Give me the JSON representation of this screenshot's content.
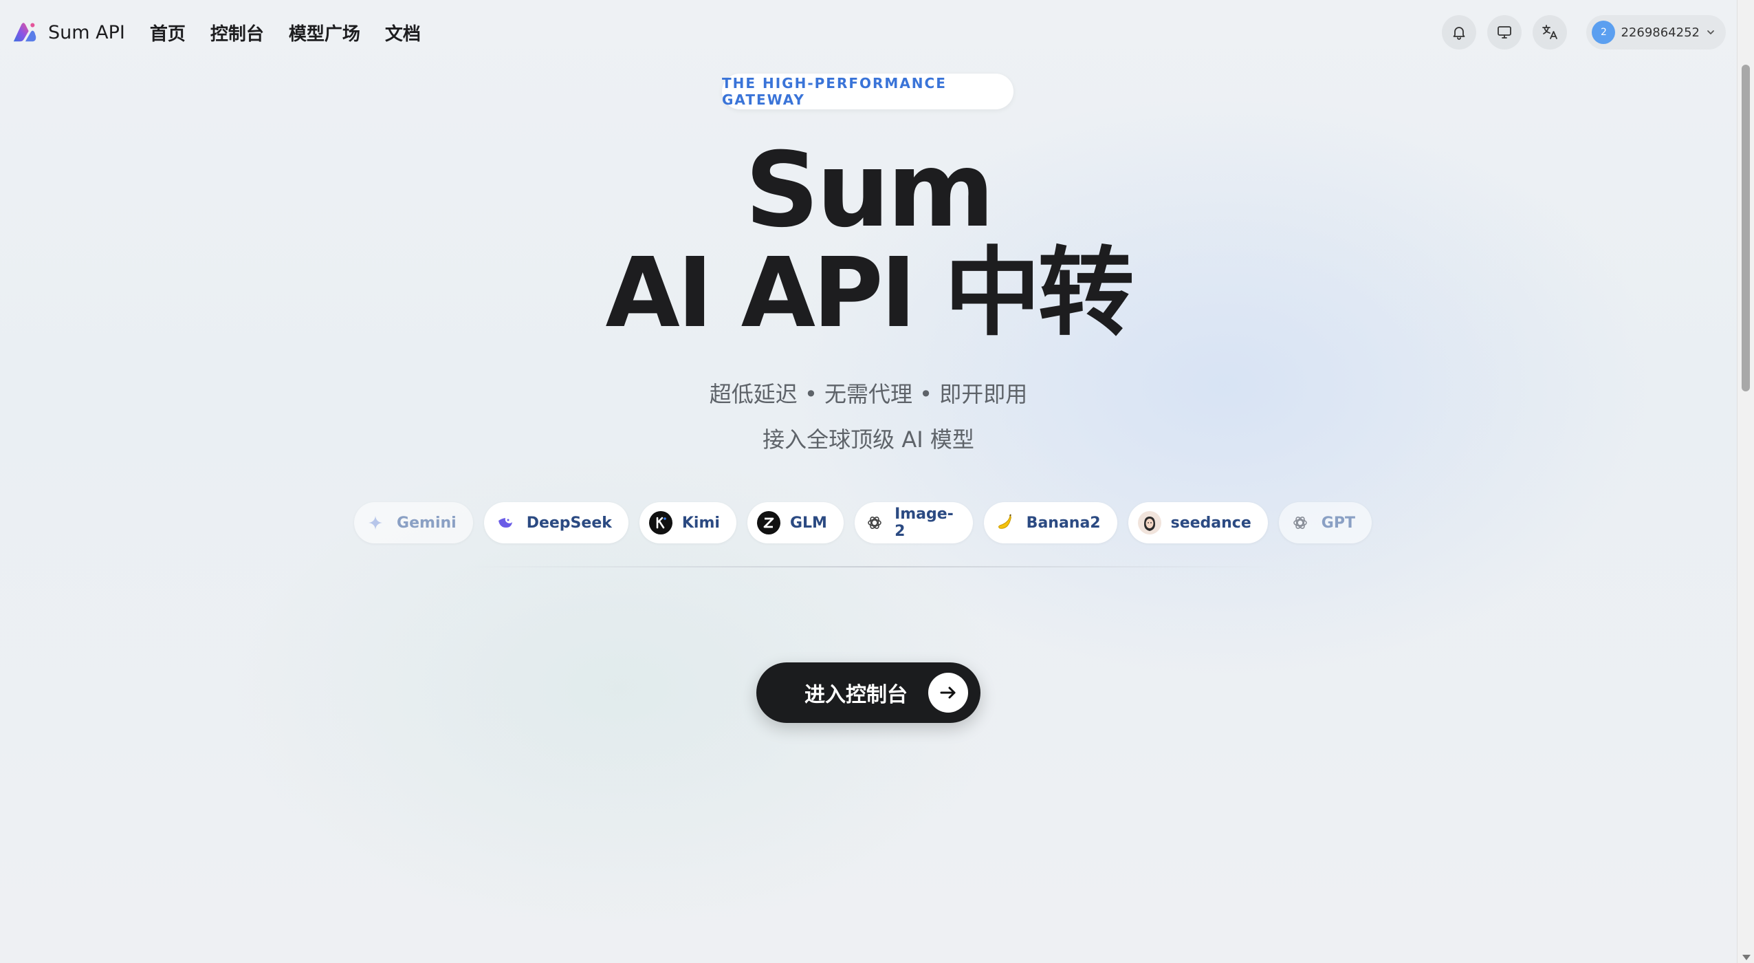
{
  "header": {
    "brand_name": "Sum API",
    "nav": [
      "首页",
      "控制台",
      "模型广场",
      "文档"
    ],
    "user": {
      "avatar_text": "2",
      "username": "2269864252"
    }
  },
  "hero": {
    "badge": "THE HIGH-PERFORMANCE GATEWAY",
    "title_line1": "Sum",
    "title_line2": "AI API 中转",
    "subtitle1": "超低延迟 • 无需代理 • 即开即用",
    "subtitle2": "接入全球顶级 AI 模型"
  },
  "models": [
    {
      "label": "Gemini",
      "icon": "gemini-icon"
    },
    {
      "label": "DeepSeek",
      "icon": "deepseek-icon"
    },
    {
      "label": "Kimi",
      "icon": "kimi-icon"
    },
    {
      "label": "GLM",
      "icon": "glm-icon"
    },
    {
      "label": "Image-2",
      "icon": "openai-icon"
    },
    {
      "label": "Banana2",
      "icon": "banana-icon"
    },
    {
      "label": "seedance",
      "icon": "seedance-icon"
    },
    {
      "label": "GPT",
      "icon": "openai-icon"
    }
  ],
  "cta": {
    "label": "进入控制台"
  },
  "colors": {
    "accent_blue": "#3a74d8",
    "chip_text": "#2b4a82",
    "cta_bg": "#1b1c1e"
  }
}
